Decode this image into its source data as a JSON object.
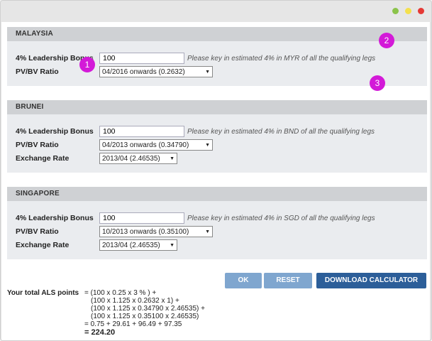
{
  "window": {
    "controls": [
      {
        "name": "minimize",
        "color": "#8bc34a"
      },
      {
        "name": "maximize",
        "color": "#f4e04d"
      },
      {
        "name": "close",
        "color": "#e53935"
      }
    ]
  },
  "sections": {
    "malaysia": {
      "title": "MALAYSIA",
      "bonus_label": "4% Leadership Bonus",
      "bonus_value": "100",
      "bonus_hint": "Please key in estimated 4% in MYR of all the qualifying legs",
      "ratio_label": "PV/BV Ratio",
      "ratio_value": "04/2016 onwards (0.2632)"
    },
    "brunei": {
      "title": "BRUNEI",
      "bonus_label": "4% Leadership Bonus",
      "bonus_value": "100",
      "bonus_hint": "Please key in estimated 4% in BND of all the qualifying legs",
      "ratio_label": "PV/BV Ratio",
      "ratio_value": "04/2013 onwards (0.34790)",
      "rate_label": "Exchange Rate",
      "rate_value": "2013/04 (2.46535)"
    },
    "singapore": {
      "title": "SINGAPORE",
      "bonus_label": "4% Leadership Bonus",
      "bonus_value": "100",
      "bonus_hint": "Please key in estimated 4% in SGD of all the qualifying legs",
      "ratio_label": "PV/BV Ratio",
      "ratio_value": "10/2013 onwards (0.35100)",
      "rate_label": "Exchange Rate",
      "rate_value": "2013/04 (2.46535)"
    }
  },
  "badges": [
    "1",
    "2",
    "3"
  ],
  "buttons": {
    "ok": "OK",
    "reset": "RESET",
    "download": "DOWNLOAD CALCULATOR"
  },
  "colors": {
    "badge": "#d31ad8",
    "button_light": "#7fa6cf",
    "button_dark": "#2c5e99"
  },
  "calculation": {
    "title": "Your total ALS points",
    "lines": [
      "= (100 x 0.25 x 3 % ) +",
      "(100 x 1.125 x 0.2632 x 1) +",
      "(100 x 1.125 x 0.34790 x 2.46535) +",
      "(100 x 1.125 x 0.35100 x 2.46535)",
      "= 0.75 + 29.61 + 96.49 + 97.35",
      "= 224.20"
    ]
  }
}
